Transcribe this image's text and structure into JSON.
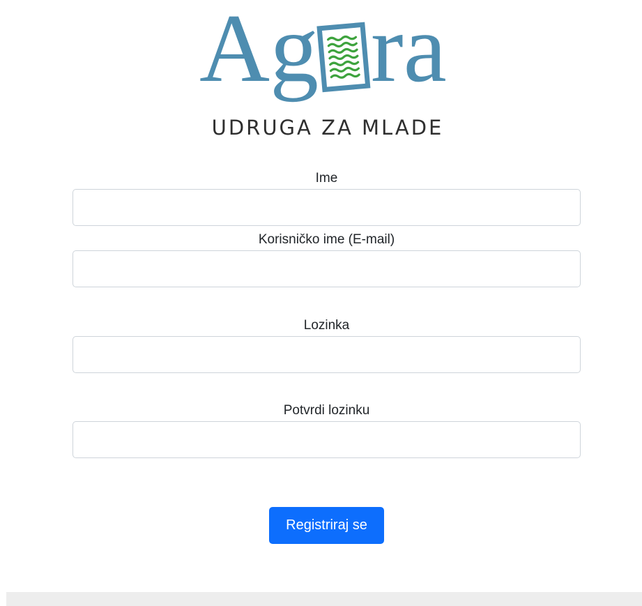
{
  "logo": {
    "wordmark_before": "Ag",
    "wordmark_after": "ra",
    "tagline": "UDRUGA ZA MLADE",
    "brand_color": "#4e8db0",
    "wave_color": "#3ea33e"
  },
  "form": {
    "name_label": "Ime",
    "name_value": "",
    "username_label": "Korisničko ime (E-mail)",
    "username_value": "",
    "password_label": "Lozinka",
    "password_value": "",
    "confirm_label": "Potvrdi lozinku",
    "confirm_value": "",
    "submit_label": "Registriraj se"
  },
  "colors": {
    "primary": "#0d6efd",
    "input_border": "#ced4da",
    "footer_bg": "#ededed"
  }
}
